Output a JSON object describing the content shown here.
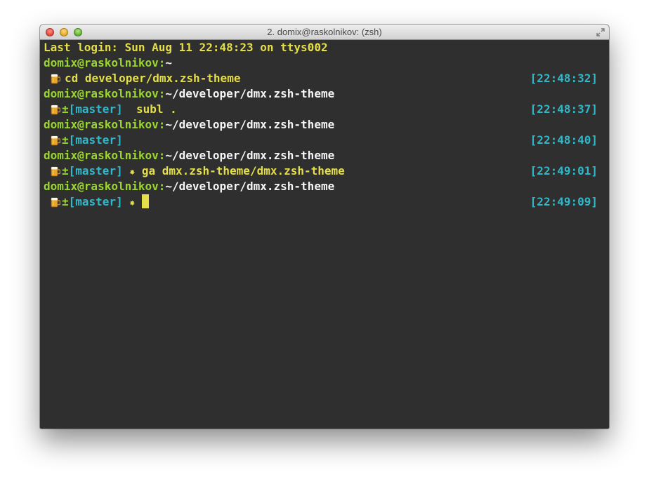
{
  "window": {
    "title": "2. domix@raskolnikov: (zsh)"
  },
  "terminal": {
    "last_login": "Last login: Sun Aug 11 22:48:23 on ttys002",
    "lines": [
      {
        "user_host": "domix@raskolnikov:",
        "path": "~"
      },
      {
        "command": "cd developer/dmx.zsh-theme",
        "time": "[22:48:32]"
      },
      {
        "user_host": "domix@raskolnikov:",
        "path": "~/developer/dmx.zsh-theme"
      },
      {
        "git_marker": "±",
        "branch": "[master]",
        "command": "subl .",
        "time": "[22:48:37]"
      },
      {
        "user_host": "domix@raskolnikov:",
        "path": "~/developer/dmx.zsh-theme"
      },
      {
        "git_marker": "±",
        "branch": "[master]",
        "time": "[22:48:40]"
      },
      {
        "user_host": "domix@raskolnikov:",
        "path": "~/developer/dmx.zsh-theme"
      },
      {
        "git_marker": "±",
        "branch": "[master]",
        "dirty": "✸",
        "command": "ga dmx.zsh-theme/dmx.zsh-theme",
        "time": "[22:49:01]"
      },
      {
        "user_host": "domix@raskolnikov:",
        "path": "~/developer/dmx.zsh-theme"
      },
      {
        "git_marker": "±",
        "branch": "[master]",
        "dirty": "✸",
        "time": "[22:49:09]"
      }
    ]
  },
  "icons": {
    "prompt": "beer-mug-icon",
    "window_controls": [
      "close-icon",
      "minimize-icon",
      "zoom-icon"
    ],
    "fullscreen": "fullscreen-icon"
  },
  "colors": {
    "background": "#2f2f2f",
    "yellow": "#e4de4a",
    "green": "#9bd531",
    "cyan": "#2fb8c9",
    "white": "#f5f5f5"
  }
}
